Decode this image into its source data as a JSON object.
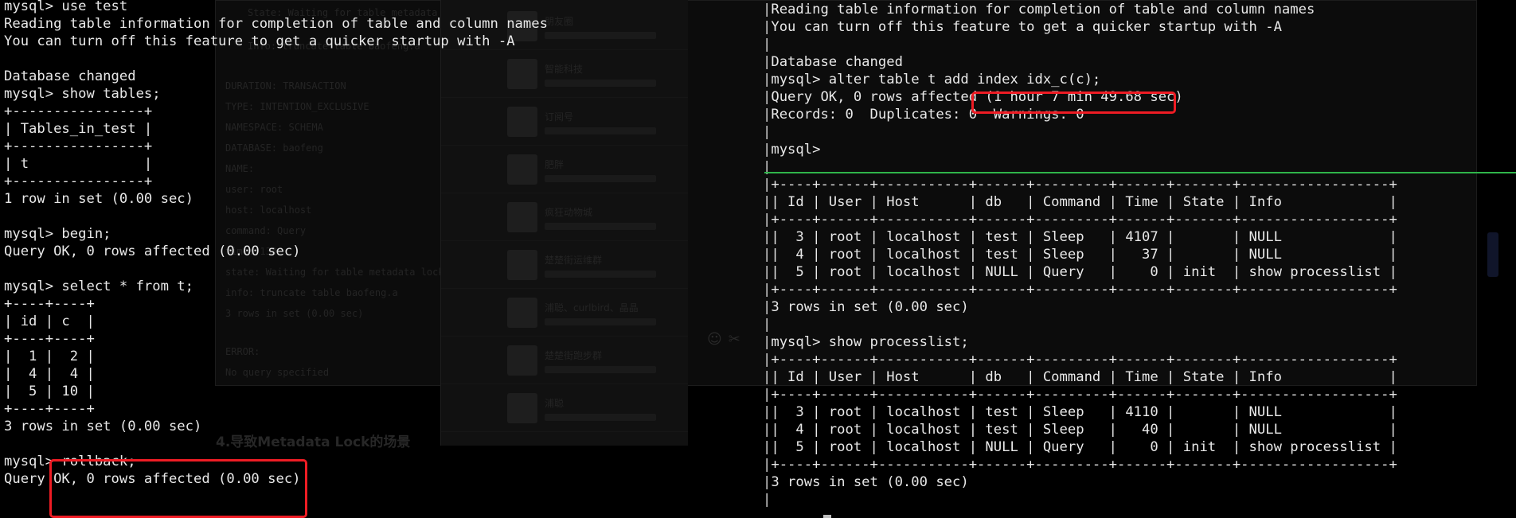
{
  "left_terminal": {
    "lines": [
      "mysql> use test",
      "Reading table information for completion of table and column names",
      "You can turn off this feature to get a quicker startup with -A",
      "",
      "Database changed",
      "mysql> show tables;",
      "+----------------+",
      "| Tables_in_test |",
      "+----------------+",
      "| t              |",
      "+----------------+",
      "1 row in set (0.00 sec)",
      "",
      "mysql> begin;",
      "Query OK, 0 rows affected (0.00 sec)",
      "",
      "mysql> select * from t;",
      "+----+----+",
      "| id | c  |",
      "+----+----+",
      "|  1 |  2 |",
      "|  4 |  4 |",
      "|  5 | 10 |",
      "+----+----+",
      "3 rows in set (0.00 sec)",
      "",
      "mysql> rollback;",
      "Query OK, 0 rows affected (0.00 sec)"
    ],
    "highlight_label": "rollback highlighted"
  },
  "right_terminal": {
    "lines": [
      "mysql> use test",
      "Reading table information for completion of table and column names",
      "You can turn off this feature to get a quicker startup with -A",
      "",
      "Database changed",
      "mysql> alter table t add index idx_c(c);",
      "Query OK, 0 rows affected (1 hour 7 min 49.68 sec)",
      "Records: 0  Duplicates: 0  Warnings: 0",
      "",
      "mysql>",
      "",
      "+----+------+-----------+------+---------+------+-------+------------------+",
      "| Id | User | Host      | db   | Command | Time | State | Info             |",
      "+----+------+-----------+------+---------+------+-------+------------------+",
      "|  3 | root | localhost | test | Sleep   | 4107 |       | NULL             |",
      "|  4 | root | localhost | test | Sleep   |   37 |       | NULL             |",
      "|  5 | root | localhost | NULL | Query   |    0 | init  | show processlist |",
      "+----+------+-----------+------+---------+------+-------+------------------+",
      "3 rows in set (0.00 sec)",
      "",
      "mysql> show processlist;",
      "+----+------+-----------+------+---------+------+-------+------------------+",
      "| Id | User | Host      | db   | Command | Time | State | Info             |",
      "+----+------+-----------+------+---------+------+-------+------------------+",
      "|  3 | root | localhost | test | Sleep   | 4110 |       | NULL             |",
      "|  4 | root | localhost | test | Sleep   |   40 |       | NULL             |",
      "|  5 | root | localhost | NULL | Query   |    0 | init  | show processlist |",
      "+----+------+-----------+------+---------+------+-------+------------------+",
      "3 rows in set (0.00 sec)",
      ""
    ]
  },
  "background": {
    "doc_heading": "4.导致Metadata Lock的场景",
    "doc_fragments": [
      "State: Waiting for table metadata lock",
      "Info: truncate table baofeng.a",
      "DURATION: TRANSACTION",
      "TYPE: INTENTION_EXCLUSIVE",
      "NAMESPACE: SCHEMA",
      "DATABASE: baofeng",
      "NAME:",
      "user: root",
      "host: localhost",
      "command: Query",
      "time: 138",
      "state: Waiting for table metadata lock",
      "info: truncate table baofeng.a",
      "3 rows in set (0.00 sec)",
      "ERROR:",
      "No query specified"
    ],
    "chat_items": [
      "朋友圈",
      "智能科技",
      "订阅号",
      "肥胖",
      "疯狂动物城",
      "楚楚街运维群",
      "浦聪、curlbird、晶晶",
      "楚楚街跑步群",
      "浦聪"
    ]
  },
  "colors": {
    "terminal_bg": "#000000",
    "terminal_text": "#e8e8e8",
    "highlight": "#ee1c24",
    "divider": "#2fb54a"
  }
}
